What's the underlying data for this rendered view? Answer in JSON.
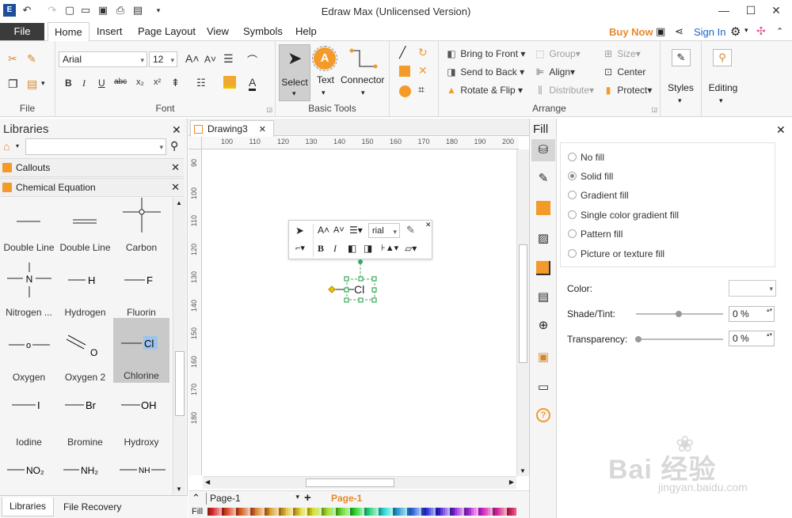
{
  "app": {
    "title": "Edraw Max (Unlicensed Version)"
  },
  "menu": {
    "file": "File",
    "tabs": [
      "Home",
      "Insert",
      "Page Layout",
      "View",
      "Symbols",
      "Help"
    ],
    "buy_now": "Buy Now",
    "sign_in": "Sign In"
  },
  "ribbon": {
    "file_group": "File",
    "font": {
      "family": "Arial",
      "size": "12",
      "label": "Font"
    },
    "basic_tools": {
      "label": "Basic Tools",
      "select": "Select",
      "text": "Text",
      "connector": "Connector"
    },
    "arrange": {
      "label": "Arrange",
      "bring_to_front": "Bring to Front",
      "send_to_back": "Send to Back",
      "rotate_flip": "Rotate & Flip",
      "group": "Group",
      "align": "Align",
      "distribute": "Distribute",
      "size": "Size",
      "center": "Center",
      "protect": "Protect"
    },
    "styles": "Styles",
    "editing": "Editing"
  },
  "libraries": {
    "title": "Libraries",
    "categories": [
      "Callouts",
      "Chemical Equation"
    ],
    "shapes": [
      {
        "label": "Double Line",
        "glyph": ""
      },
      {
        "label": "Double Line",
        "glyph": ""
      },
      {
        "label": "Carbon",
        "glyph": ""
      },
      {
        "label": "Nitrogen ...",
        "glyph": "N"
      },
      {
        "label": "Hydrogen",
        "glyph": "H"
      },
      {
        "label": "Fluorin",
        "glyph": "F"
      },
      {
        "label": "Oxygen",
        "glyph": "o"
      },
      {
        "label": "Oxygen 2",
        "glyph": "O"
      },
      {
        "label": "Chlorine",
        "glyph": "Cl"
      },
      {
        "label": "Iodine",
        "glyph": "I"
      },
      {
        "label": "Bromine",
        "glyph": "Br"
      },
      {
        "label": "Hydroxy",
        "glyph": "OH"
      },
      {
        "label": "",
        "glyph": "NO₂"
      },
      {
        "label": "",
        "glyph": "NH₂"
      },
      {
        "label": "",
        "glyph": "NH"
      }
    ],
    "bottom_tabs": [
      "Libraries",
      "File Recovery"
    ]
  },
  "document": {
    "tab": "Drawing3",
    "ruler_h": [
      "100",
      "110",
      "120",
      "130",
      "140",
      "150",
      "160",
      "170",
      "180",
      "190",
      "200"
    ],
    "ruler_v": [
      "90",
      "100",
      "110",
      "120",
      "130",
      "140",
      "150",
      "160",
      "170",
      "180"
    ],
    "canvas_label": "Cl",
    "mini_font": "rial",
    "page_select": "Page-1",
    "page_tab": "Page-1",
    "fill_label": "Fill"
  },
  "fill": {
    "title": "Fill",
    "options": [
      "No fill",
      "Solid fill",
      "Gradient fill",
      "Single color gradient fill",
      "Pattern fill",
      "Picture or texture fill"
    ],
    "selected": 1,
    "color_label": "Color:",
    "shade_label": "Shade/Tint:",
    "shade_value": "0 %",
    "transparency_label": "Transparency:",
    "transparency_value": "0 %"
  },
  "watermark": {
    "line1": "Bai  经验",
    "line2": "jingyan.baidu.com"
  },
  "colors": {
    "accent": "#f39a2a",
    "file_tab": "#3b3b3b",
    "selection": "#3aa85a",
    "link": "#1a64c8"
  }
}
